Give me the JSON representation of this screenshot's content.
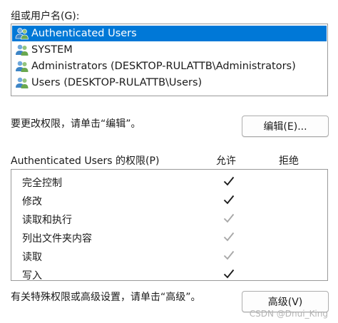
{
  "group_label": "组或用户名(G):",
  "users": [
    {
      "name": "Authenticated Users",
      "selected": true
    },
    {
      "name": "SYSTEM",
      "selected": false
    },
    {
      "name": "Administrators (DESKTOP-RULATTB\\Administrators)",
      "selected": false
    },
    {
      "name": "Users (DESKTOP-RULATTB\\Users)",
      "selected": false
    }
  ],
  "change_hint": "要更改权限，请单击“编辑”。",
  "edit_button": "编辑(E)...",
  "permissions_header": "Authenticated Users 的权限(P)",
  "allow_header": "允许",
  "deny_header": "拒绝",
  "permissions": [
    {
      "name": "完全控制",
      "allow": "dark"
    },
    {
      "name": "修改",
      "allow": "dark"
    },
    {
      "name": "读取和执行",
      "allow": "grey"
    },
    {
      "name": "列出文件夹内容",
      "allow": "grey"
    },
    {
      "name": "读取",
      "allow": "grey"
    },
    {
      "name": "写入",
      "allow": "dark"
    }
  ],
  "advanced_hint": "有关特殊权限或高级设置，请单击“高级”。",
  "advanced_button": "高级(V)",
  "watermark": "CSDN @Dnui_King",
  "colors": {
    "selection": "#0078d7",
    "check_dark": "#1a1a1a",
    "check_grey": "#a8a8a8"
  },
  "icons": {
    "user": "user-group-icon",
    "check": "checkmark-icon"
  }
}
